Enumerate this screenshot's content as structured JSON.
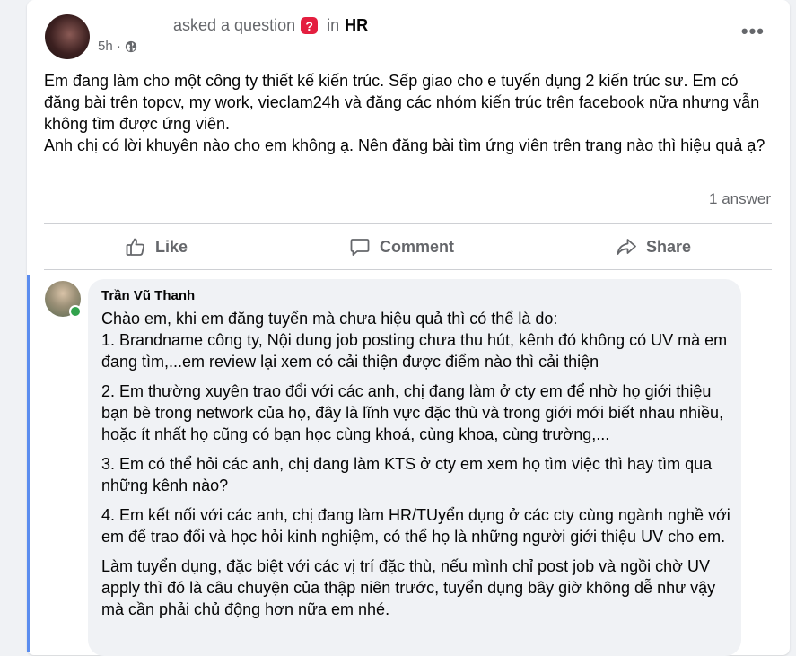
{
  "post": {
    "asked_text": "asked a question",
    "in_text": "in",
    "group": "HR",
    "time": "5h ·",
    "more": "•••",
    "body": [
      "Em đang làm cho một công ty thiết kế kiến trúc. Sếp giao cho e tuyển dụng 2 kiến trúc sư. Em có đăng bài trên topcv, my work, vieclam24h và đăng các nhóm kiến trúc trên facebook nữa nhưng vẫn không tìm được ứng viên.",
      "Anh chị có lời khuyên nào cho em không ạ. Nên đăng bài tìm ứng viên trên trang nào thì hiệu quả ạ?"
    ],
    "answer_count": "1 answer"
  },
  "actions": {
    "like": "Like",
    "comment": "Comment",
    "share": "Share"
  },
  "comment": {
    "author": "Trần Vũ Thanh",
    "paragraphs": [
      "Chào em, khi em đăng tuyển mà chưa hiệu quả thì có thể là do:\n1. Brandname công ty, Nội dung job posting chưa thu hút, kênh đó không có UV mà em đang tìm,...em review lại xem có cải thiện được điểm nào thì cải thiện",
      "2. Em thường xuyên trao đổi với các anh, chị đang làm ở cty em để nhờ họ giới thiệu bạn bè trong network của họ, đây là lĩnh vực đặc thù và trong giới mới biết nhau nhiều, hoặc ít nhất họ cũng có bạn học cùng khoá, cùng khoa, cùng trường,...",
      "3. Em có thể hỏi các anh, chị đang làm KTS ở cty em xem họ tìm việc thì hay tìm qua những kênh nào?",
      "4. Em kết nối với các anh, chị đang làm HR/TUyển dụng ở các cty cùng ngành nghề với em để trao đổi và học hỏi kinh nghiệm, có thể họ là những người giới thiệu UV cho em.",
      "Làm tuyển dụng, đặc biệt với các vị trí đặc thù, nếu mình chỉ post job và ngồi chờ UV apply thì đó là câu chuyện của thập niên trước, tuyển dụng bây giờ không dễ như vậy mà cần phải chủ động hơn nữa em nhé."
    ]
  },
  "colors": {
    "question_badge": "#e41e3f",
    "thread_line": "#5b8def",
    "online": "#31a24c"
  }
}
